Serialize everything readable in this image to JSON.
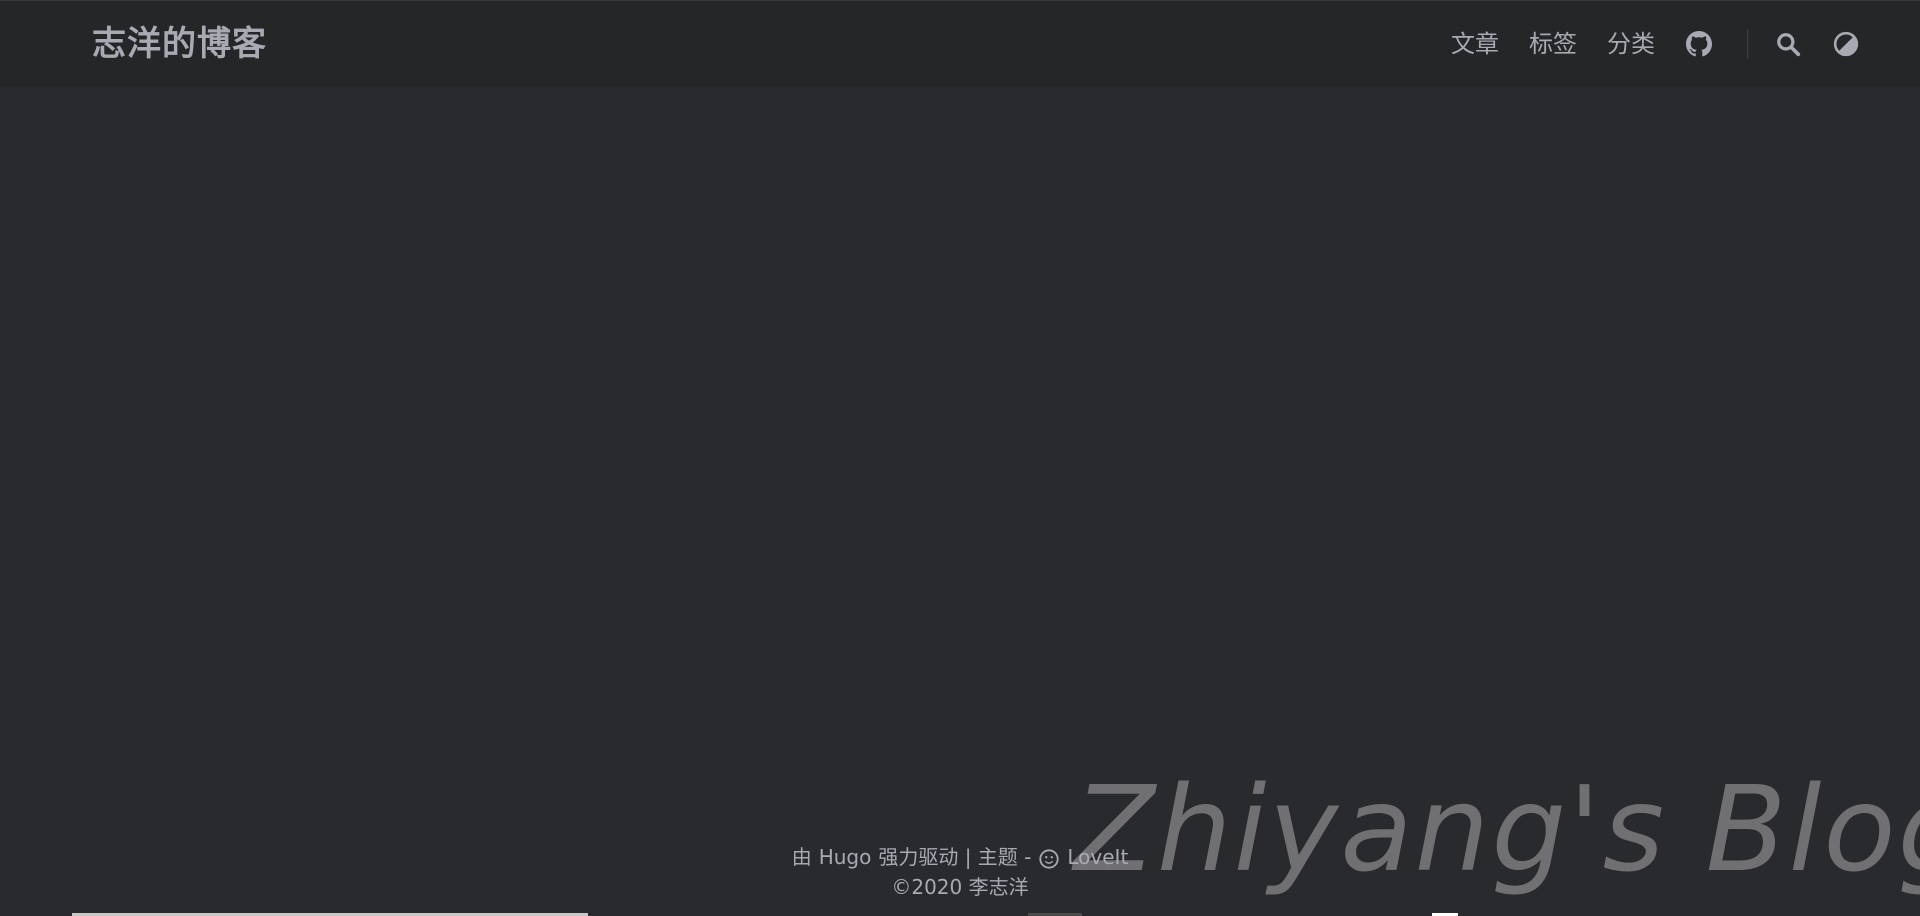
{
  "header": {
    "site_title": "志洋的博客",
    "nav": [
      {
        "label": "文章"
      },
      {
        "label": "标签"
      },
      {
        "label": "分类"
      }
    ],
    "icons": [
      "github-icon",
      "search-icon",
      "theme-toggle-icon"
    ]
  },
  "footer": {
    "powered_prefix": "由",
    "hugo": "Hugo",
    "powered_suffix": "强力驱动 | 主题 -",
    "theme_name": "LoveIt",
    "copyright": "©2020 李志洋"
  },
  "watermark": "Zhiyang's Blog",
  "colors": {
    "background": "#292a2e",
    "header_bg": "#252627",
    "text": "#a9a9b3",
    "watermark": "#747476"
  }
}
